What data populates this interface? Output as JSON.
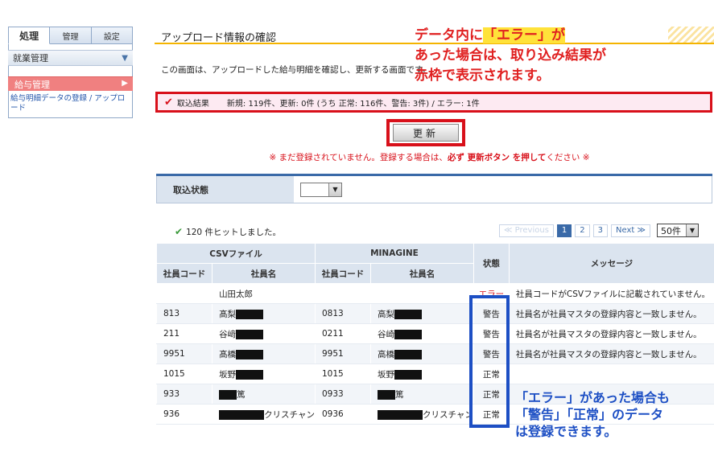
{
  "sidebar": {
    "tabs": [
      "処理",
      "管理",
      "設定"
    ],
    "menu_head": "就業管理",
    "active_item": "給与管理",
    "sub_link": "給与明細データの登録 / アップロード"
  },
  "main": {
    "title": "アップロード情報の確認",
    "description": "この画面は、アップロードした給与明細を確認し、更新する画面です。",
    "result_label": "取込結果",
    "result_text": "新規: 119件、更新: 0件 (うち 正常: 116件、警告: 3件) / エラー: 1件",
    "update_button": "更新",
    "warning_prefix": "※ まだ登録されていません。登録する場合は、",
    "warning_bold": "必ず 更新ボタン を押して",
    "warning_suffix": "ください ※",
    "filter_label": "取込状態",
    "hits_text": "120 件ヒットしました。",
    "pager": {
      "prev": "≪ Previous",
      "pages": [
        "1",
        "2",
        "3"
      ],
      "next": "Next ≫",
      "per_page": "50件"
    }
  },
  "table": {
    "group_csv": "CSVファイル",
    "group_minagine": "MINAGINE",
    "col_code": "社員コード",
    "col_name": "社員名",
    "col_status": "状態",
    "col_message": "メッセージ",
    "rows": [
      {
        "csv_code": "",
        "csv_name": "山田太郎",
        "m_code": "",
        "m_name": "",
        "status": "エラー",
        "message": "社員コードがCSVファイルに記載されていません。"
      },
      {
        "csv_code": "813",
        "csv_name": "髙梨",
        "m_code": "0813",
        "m_name": "高梨",
        "status": "警告",
        "message": "社員名が社員マスタの登録内容と一致しません。"
      },
      {
        "csv_code": "211",
        "csv_name": "谷﨑",
        "m_code": "0211",
        "m_name": "谷崎",
        "status": "警告",
        "message": "社員名が社員マスタの登録内容と一致しません。"
      },
      {
        "csv_code": "9951",
        "csv_name": "髙橋",
        "m_code": "9951",
        "m_name": "高橋",
        "status": "警告",
        "message": "社員名が社員マスタの登録内容と一致しません。"
      },
      {
        "csv_code": "1015",
        "csv_name": "坂野",
        "m_code": "1015",
        "m_name": "坂野",
        "status": "正常",
        "message": ""
      },
      {
        "csv_code": "933",
        "csv_name": "篤",
        "m_code": "0933",
        "m_name": "篤",
        "status": "正常",
        "message": ""
      },
      {
        "csv_code": "936",
        "csv_name": "クリスチャン",
        "m_code": "0936",
        "m_name": "クリスチャン",
        "status": "正常",
        "message": ""
      }
    ]
  },
  "annotations": {
    "top_line1_pre": "データ内に",
    "top_line1_hl": "「エラー」が",
    "top_line2": "あった場合は、取り込み結果が",
    "top_line3": "赤枠で表示されます。",
    "bottom_line1": "「エラー」があった場合も",
    "bottom_line2": "「警告」「正常」のデータ",
    "bottom_line3": "は登録できます。"
  },
  "colors": {
    "accent_red": "#d8101a",
    "accent_blue": "#1d4fc4",
    "title_rule": "#f4b400"
  }
}
